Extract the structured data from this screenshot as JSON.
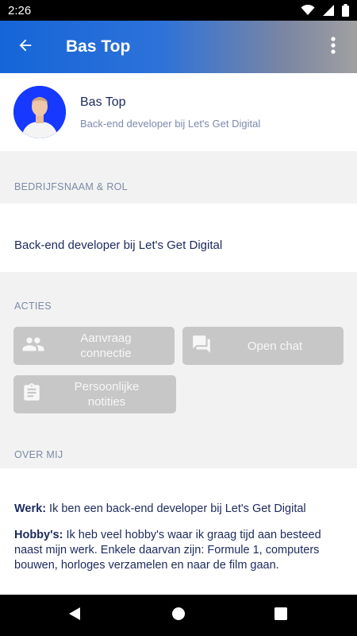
{
  "status_bar": {
    "time": "2:26"
  },
  "app_bar": {
    "title": "Bas Top"
  },
  "profile": {
    "name": "Bas Top",
    "role": "Back-end developer bij Let's Get Digital"
  },
  "sections": {
    "company": {
      "header": "BEDRIJFSNAAM & ROL",
      "text": "Back-end developer bij Let's Get Digital"
    },
    "actions": {
      "header": "ACTIES",
      "buttons": [
        {
          "label_line1": "Aanvraag",
          "label_line2": "connectie",
          "icon": "people-icon"
        },
        {
          "label": "Open chat",
          "icon": "chat-icon"
        },
        {
          "label_line1": "Persoonlijke",
          "label_line2": "notities",
          "icon": "clipboard-icon"
        }
      ]
    },
    "about": {
      "header": "OVER MIJ",
      "work_label": "Werk:",
      "work_text": " Ik ben een back-end developer bij Let's Get Digital",
      "hobby_label": "Hobby's:",
      "hobby_text": " Ik heb veel hobby's waar ik graag tijd aan besteed naast mijn werk. Enkele daarvan zijn: Formule 1, computers bouwen, horloges verzamelen en naar de film gaan."
    }
  },
  "colors": {
    "accent": "#1565d8",
    "text": "#1c2a5c",
    "muted": "#7b8aa6",
    "button_disabled": "#c7c7c7",
    "avatar_bg": "#1739ff"
  }
}
